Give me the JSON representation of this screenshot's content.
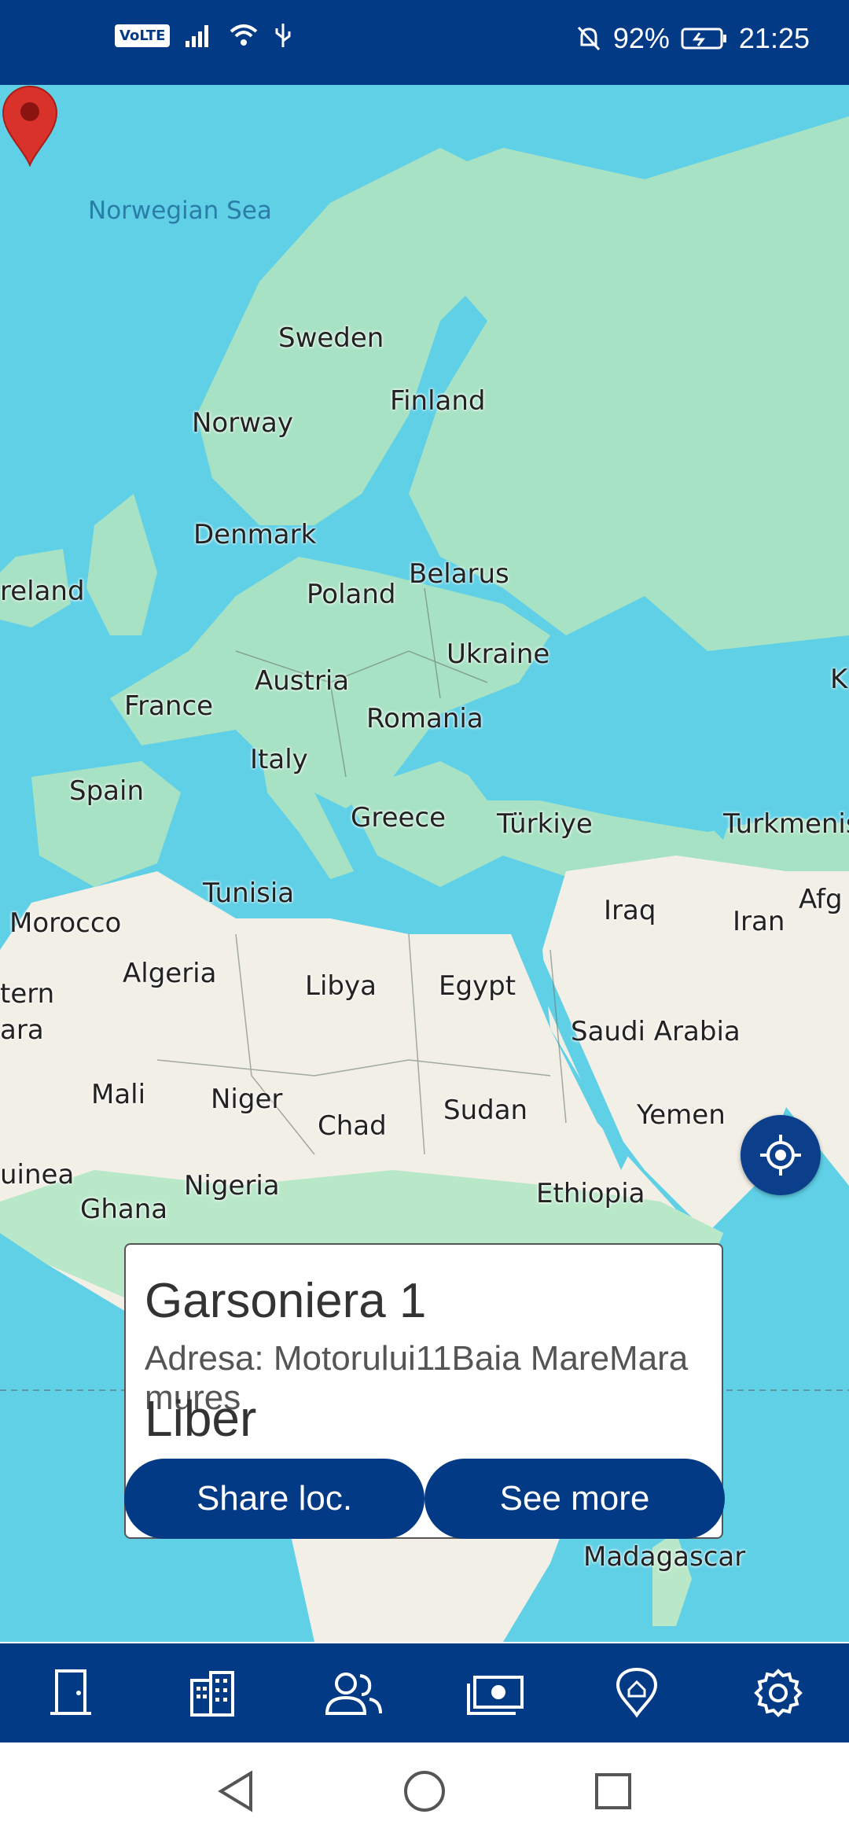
{
  "status_bar": {
    "volte": "VoLTE",
    "battery_percent": "92%",
    "time": "21:25",
    "icons": [
      "signal-icon",
      "wifi-icon",
      "usb-icon",
      "mute-icon",
      "battery-charging-icon"
    ]
  },
  "map": {
    "labels": {
      "norwegian_sea": "Norwegian Sea",
      "sweden": "Sweden",
      "finland": "Finland",
      "norway": "Norway",
      "denmark": "Denmark",
      "ireland": "reland",
      "poland": "Poland",
      "belarus": "Belarus",
      "ukraine": "Ukraine",
      "austria": "Austria",
      "france": "France",
      "romania": "Romania",
      "italy": "Italy",
      "spain": "Spain",
      "greece": "Greece",
      "turkiye": "Türkiye",
      "turkmenis": "Turkmenis",
      "tunisia": "Tunisia",
      "iraq": "Iraq",
      "iran": "Iran",
      "afg": "Afg",
      "morocco": "Morocco",
      "algeria": "Algeria",
      "libya": "Libya",
      "egypt": "Egypt",
      "tern": "tern",
      "ara": "ara",
      "saudi": "Saudi Arabia",
      "mali": "Mali",
      "niger": "Niger",
      "chad": "Chad",
      "sudan": "Sudan",
      "yemen": "Yemen",
      "uinea": "uinea",
      "nigeria": "Nigeria",
      "ghana": "Ghana",
      "ethiopia": "Ethiopia",
      "madagascar": "Madagascar",
      "k": "K"
    },
    "colors": {
      "water": "#5fd0e6",
      "land_green": "#a8e2c4",
      "land_sand": "#f2efe6",
      "pin": "#d9322a",
      "brand": "#033a85"
    }
  },
  "card": {
    "title": "Garsoniera 1",
    "address": "Adresa: Motorului11Baia MareMaramures",
    "status": "Liber",
    "share_label": "Share loc.",
    "more_label": "See more"
  },
  "bottom_nav": {
    "items": [
      "door-icon",
      "building-icon",
      "people-icon",
      "money-icon",
      "location-icon",
      "settings-icon"
    ]
  },
  "system_nav": [
    "back-icon",
    "home-icon",
    "recents-icon"
  ]
}
